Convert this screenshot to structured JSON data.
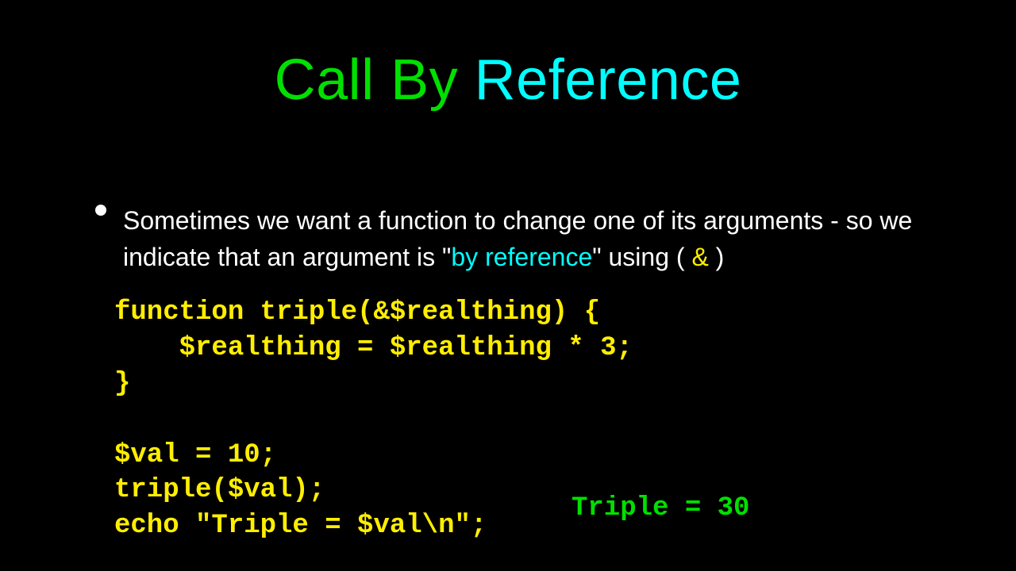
{
  "title": {
    "part1": "Call By ",
    "part2": "Reference"
  },
  "body": {
    "pre": "Sometimes we want a function to change one of its arguments - so we indicate that an argument is \"",
    "cyan": "by reference",
    "mid": "\" using ( ",
    "amp": "&",
    "post": " )"
  },
  "code": "function triple(&$realthing) {\n    $realthing = $realthing * 3;\n}\n\n$val = 10;\ntriple($val);\necho \"Triple = $val\\n\";",
  "output": "Triple = 30"
}
